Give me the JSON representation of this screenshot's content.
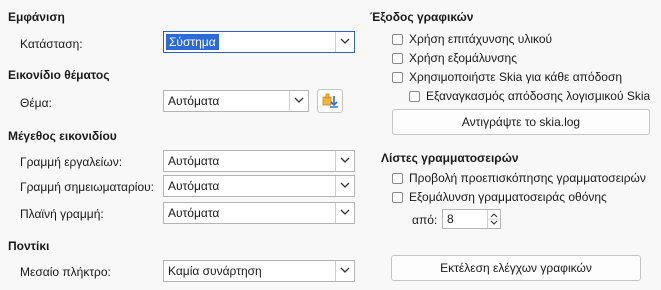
{
  "appearance": {
    "heading": "Εμφάνιση",
    "mode_label": "Κατάσταση:",
    "mode_value": "Σύστημα"
  },
  "icon_theme": {
    "heading": "Εικονίδιο θέματος",
    "theme_label": "Θέμα:",
    "theme_value": "Αυτόματα"
  },
  "icon_size": {
    "heading": "Μέγεθος εικονιδίου",
    "toolbar_label": "Γραμμή εργαλείων:",
    "toolbar_value": "Αυτόματα",
    "notebookbar_label": "Γραμμή σημειωματαρίου:",
    "notebookbar_value": "Αυτόματα",
    "sidebar_label": "Πλαϊνή γραμμή:",
    "sidebar_value": "Αυτόματα"
  },
  "mouse": {
    "heading": "Ποντίκι",
    "middle_button_label": "Μεσαίο πλήκτρο:",
    "middle_button_value": "Καμία συνάρτηση"
  },
  "graphics_output": {
    "heading": "Έξοδος γραφικών",
    "hardware_accel": "Χρήση επιτάχυνσης υλικού",
    "antialiasing": "Χρήση εξομάλυνσης",
    "skia": "Χρησιμοποιήστε  Skia για κάθε απόδοση",
    "force_skia_software": "Εξαναγκασμός απόδοσης λογισμικού Skia",
    "copy_skia_log": "Αντιγράψτε το skia.log"
  },
  "font_lists": {
    "heading": "Λίστες γραμματοσειρών",
    "show_preview": "Προβολή προεπισκόπησης γραμματοσειρών",
    "screen_font_antialias": "Εξομάλυνση γραμματοσειράς οθόνης",
    "from_label": "από:",
    "from_value": "8"
  },
  "run_graphics_tests": "Εκτέλεση ελέγχων γραφικών"
}
